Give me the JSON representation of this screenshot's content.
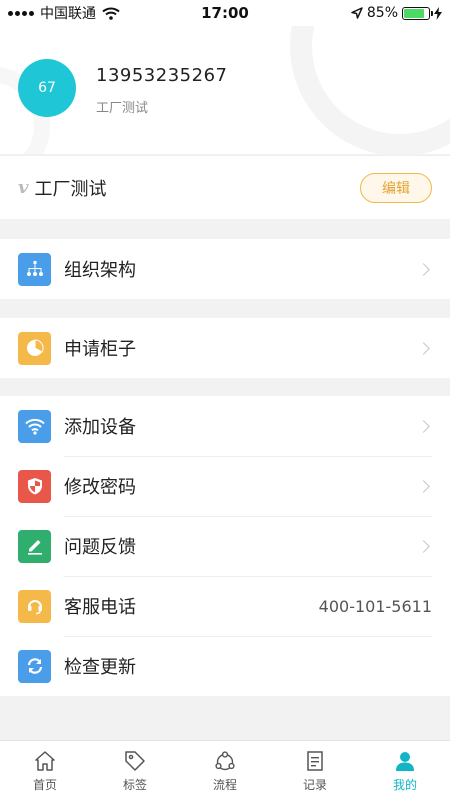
{
  "status_bar": {
    "carrier": "中国联通",
    "time": "17:00",
    "battery_percent": "85%",
    "battery_level": 0.85
  },
  "profile": {
    "avatar_text": "67",
    "phone": "13953235267",
    "company": "工厂测试"
  },
  "company_row": {
    "name": "工厂测试",
    "edit_label": "编辑"
  },
  "menu": {
    "org": {
      "label": "组织架构",
      "icon": "org-chart-icon",
      "color": "#4a9de8"
    },
    "apply": {
      "label": "申请柜子",
      "icon": "pie-chart-icon",
      "color": "#f5b94a"
    },
    "add_device": {
      "label": "添加设备",
      "icon": "wifi-icon",
      "color": "#4a9de8"
    },
    "change_password": {
      "label": "修改密码",
      "icon": "shield-icon",
      "color": "#e8574a"
    },
    "feedback": {
      "label": "问题反馈",
      "icon": "edit-icon",
      "color": "#2fae6e"
    },
    "service": {
      "label": "客服电话",
      "icon": "headset-icon",
      "color": "#f5b94a",
      "value": "400-101-5611"
    },
    "update": {
      "label": "检查更新",
      "icon": "refresh-icon",
      "color": "#4a9de8"
    }
  },
  "tabbar": {
    "home": "首页",
    "tags": "标签",
    "flow": "流程",
    "records": "记录",
    "mine": "我的",
    "active_color": "#11b5c7"
  }
}
